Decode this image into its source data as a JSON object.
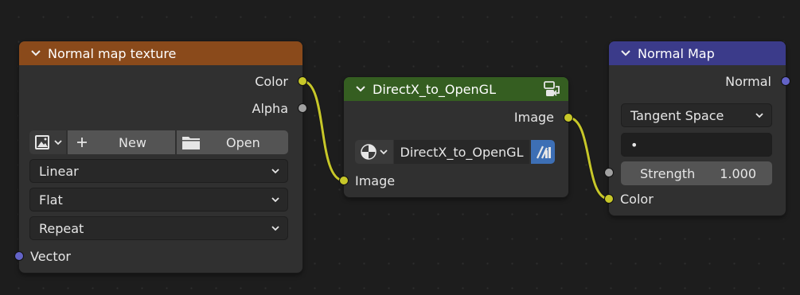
{
  "nodes": {
    "texture": {
      "title": "Normal map texture",
      "header_color": "#8a4a1b",
      "outputs": {
        "color": "Color",
        "alpha": "Alpha"
      },
      "buttons": {
        "new": "New",
        "open": "Open"
      },
      "interpolation": "Linear",
      "projection": "Flat",
      "extension": "Repeat",
      "input_vector": "Vector"
    },
    "group": {
      "title": "DirectX_to_OpenGL",
      "header_color": "#355e21",
      "output_image": "Image",
      "datablock": "DirectX_to_OpenGL",
      "input_image": "Image"
    },
    "normal_map": {
      "title": "Normal Map",
      "header_color": "#3b3b8a",
      "output_normal": "Normal",
      "space": "Tangent Space",
      "uv_map": "•",
      "strength_label": "Strength",
      "strength_value": "1.000",
      "input_color": "Color"
    }
  },
  "colors": {
    "socket_color": "#c7c729",
    "socket_float": "#a1a1a1",
    "socket_vector": "#6363c7",
    "link": "#c7c729",
    "background": "#1d1d1d",
    "accent_blue": "#3d6fb5"
  },
  "icons": [
    "chevron-down-icon",
    "image-browse-icon",
    "plus-icon",
    "folder-icon",
    "node-group-icon",
    "shader-sphere-icon",
    "fake-user-icon"
  ]
}
